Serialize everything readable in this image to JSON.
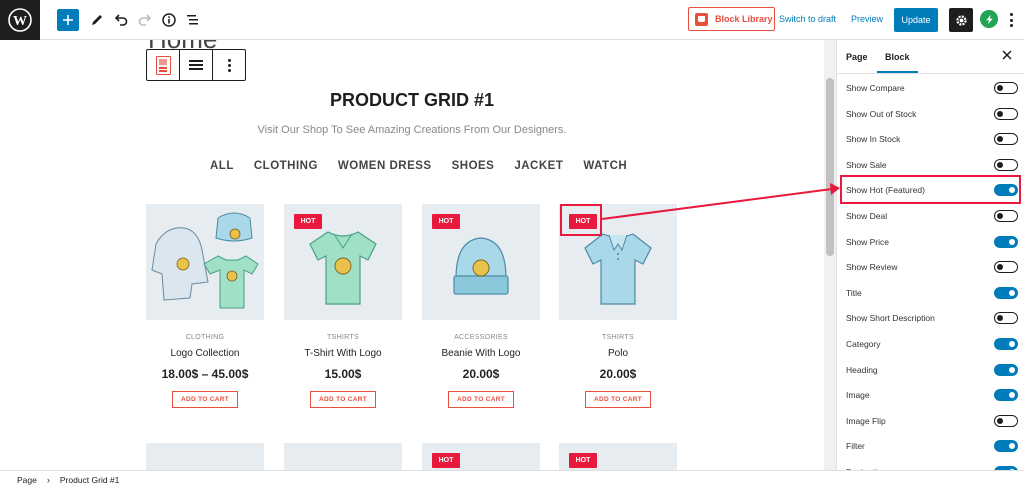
{
  "toolbar": {
    "block_library_label": "Block Library",
    "switch_to_draft_label": "Switch to draft",
    "preview_label": "Preview",
    "update_label": "Update"
  },
  "canvas": {
    "page_title": "Home",
    "grid_title": "PRODUCT GRID #1",
    "grid_subtitle": "Visit Our Shop To See Amazing Creations From Our Designers.",
    "filters": [
      "ALL",
      "CLOTHING",
      "WOMEN DRESS",
      "SHOES",
      "JACKET",
      "WATCH"
    ],
    "cart_label": "ADD TO CART",
    "hot_label": "HOT",
    "products": [
      {
        "category": "CLOTHING",
        "name": "Logo Collection",
        "price": "18.00$ – 45.00$",
        "hot": false
      },
      {
        "category": "TSHIRTS",
        "name": "T-Shirt With Logo",
        "price": "15.00$",
        "hot": true
      },
      {
        "category": "ACCESSORIES",
        "name": "Beanie With Logo",
        "price": "20.00$",
        "hot": true
      },
      {
        "category": "TSHIRTS",
        "name": "Polo",
        "price": "20.00$",
        "hot": true
      }
    ],
    "second_row_hot": [
      false,
      false,
      true,
      true
    ]
  },
  "sidebar": {
    "tabs": [
      "Page",
      "Block"
    ],
    "active_tab": "Block",
    "options": [
      {
        "label": "Show Compare",
        "on": false
      },
      {
        "label": "Show Out of Stock",
        "on": false
      },
      {
        "label": "Show In Stock",
        "on": false
      },
      {
        "label": "Show Sale",
        "on": false
      },
      {
        "label": "Show Hot (Featured)",
        "on": true
      },
      {
        "label": "Show Deal",
        "on": false
      },
      {
        "label": "Show Price",
        "on": true
      },
      {
        "label": "Show Review",
        "on": false
      },
      {
        "label": "Title",
        "on": true
      },
      {
        "label": "Show Short Description",
        "on": false
      },
      {
        "label": "Category",
        "on": true
      },
      {
        "label": "Heading",
        "on": true
      },
      {
        "label": "Image",
        "on": true
      },
      {
        "label": "Image Flip",
        "on": false
      },
      {
        "label": "Filter",
        "on": true
      },
      {
        "label": "Pagination",
        "on": true
      }
    ]
  },
  "breadcrumb": {
    "root": "Page",
    "current": "Product Grid #1"
  },
  "colors": {
    "accent": "#007cba",
    "brand_red": "#e94f3f",
    "hot_red": "#e8193c",
    "product_bg": "#e6ecf0"
  }
}
